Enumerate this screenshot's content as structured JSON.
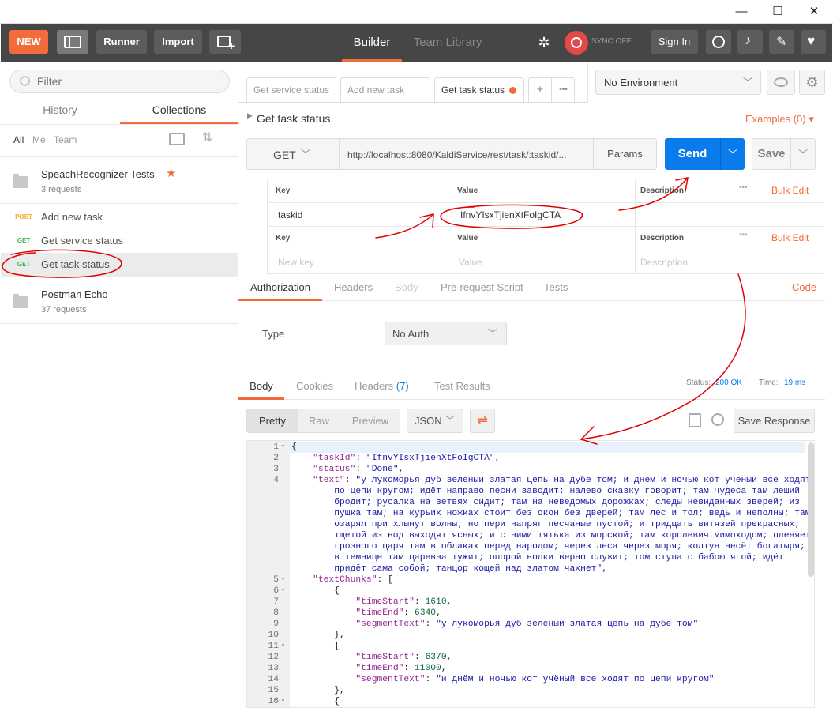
{
  "window": {
    "min": "—",
    "max": "☐",
    "close": "✕"
  },
  "topbar": {
    "new_label": "NEW",
    "runner_label": "Runner",
    "import_label": "Import",
    "builder_tab": "Builder",
    "team_library_tab": "Team Library",
    "sync_label": "SYNC OFF",
    "sign_in_label": "Sign In"
  },
  "sidebar": {
    "filter_placeholder": "Filter",
    "tabs": [
      "History",
      "Collections"
    ],
    "filters": [
      "All",
      "Me",
      "Team"
    ],
    "collections": [
      {
        "name": "SpeachRecognizer Tests",
        "count": "3 requests"
      },
      {
        "name": "Postman Echo",
        "count": "37 requests"
      }
    ],
    "requests": [
      {
        "method": "POST",
        "name": "Add new task"
      },
      {
        "method": "GET",
        "name": "Get service status"
      },
      {
        "method": "GET",
        "name": "Get task status"
      }
    ]
  },
  "tabs": [
    "Get service status",
    "Add new task",
    "Get task status"
  ],
  "tab_add": "+",
  "tab_more": "•••",
  "environment": "No Environment",
  "request": {
    "name": "Get task status",
    "examples": "Examples (0)",
    "method": "GET",
    "url": "http://localhost:8080/KaldiService/rest/task/:taskid/...",
    "params": "Params",
    "send": "Send",
    "save": "Save"
  },
  "path_vars": {
    "headers": [
      "Key",
      "Value",
      "Description"
    ],
    "bulk_edit": "Bulk Edit",
    "rows": [
      {
        "key": "taskid",
        "value": "IfnvYIsxTjienXtFoIgCTA",
        "description": ""
      }
    ]
  },
  "query_params": {
    "headers": [
      "Key",
      "Value",
      "Description"
    ],
    "bulk_edit": "Bulk Edit",
    "placeholders": {
      "key": "New key",
      "value": "Value",
      "description": "Description"
    }
  },
  "req_tabs": [
    "Authorization",
    "Headers",
    "Body",
    "Pre-request Script",
    "Tests"
  ],
  "code_link": "Code",
  "auth": {
    "type_label": "Type",
    "type_value": "No Auth"
  },
  "resp_tabs": {
    "body": "Body",
    "cookies": "Cookies",
    "headers": "Headers",
    "headers_count": "(7)",
    "tests": "Test Results"
  },
  "status": {
    "status_label": "Status:",
    "status_value": "200 OK",
    "time_label": "Time:",
    "time_value": "19 ms"
  },
  "view_modes": [
    "Pretty",
    "Raw",
    "Preview"
  ],
  "format": "JSON",
  "save_response": "Save Response",
  "json_lines": [
    {
      "n": "1",
      "fold": "▾",
      "code": "{"
    },
    {
      "n": "2",
      "fold": "",
      "code": "    \"taskId\": \"IfnvYIsxTjienXtFoIgCTA\","
    },
    {
      "n": "3",
      "fold": "",
      "code": "    \"status\": \"Done\","
    },
    {
      "n": "4",
      "fold": "",
      "code": "    \"text\": \"у лукоморья дуб зелёный златая цепь на дубе том; и днём и ночью кот учёный все ходят"
    },
    {
      "n": "",
      "fold": "",
      "code": "        по цепи кругом; идёт направо песни заводит; налево сказку говорит; там чудеса там леший"
    },
    {
      "n": "",
      "fold": "",
      "code": "        бродит; русалка на ветвях сидит; там на неведомых дорожках; следы невиданных зверей; из"
    },
    {
      "n": "",
      "fold": "",
      "code": "        пушка там; на курьих ножках стоит без окон без дверей; там лес и тол; ведь и неполны; там"
    },
    {
      "n": "",
      "fold": "",
      "code": "        озарял при хлынут волны; но пери напряг песчаные пустой; и тридцать витязей прекрасных;"
    },
    {
      "n": "",
      "fold": "",
      "code": "        тщетой из вод выходят ясных; и с ними тятька из морской; там королевич мимоходом; пленяет"
    },
    {
      "n": "",
      "fold": "",
      "code": "        грозного царя там в облаках перед народом; через леса через моря; колтун несёт богатыря;"
    },
    {
      "n": "",
      "fold": "",
      "code": "        в темнице там царевна тужит; опорой волки верно служит; том ступа с бабою ягой; идёт"
    },
    {
      "n": "",
      "fold": "",
      "code": "        придёт сама собой; танцор кощей над златом чахнет\","
    },
    {
      "n": "5",
      "fold": "▾",
      "code": "    \"textChunks\": ["
    },
    {
      "n": "6",
      "fold": "▾",
      "code": "        {"
    },
    {
      "n": "7",
      "fold": "",
      "code": "            \"timeStart\": 1610,"
    },
    {
      "n": "8",
      "fold": "",
      "code": "            \"timeEnd\": 6340,"
    },
    {
      "n": "9",
      "fold": "",
      "code": "            \"segmentText\": \"у лукоморья дуб зелёный златая цепь на дубе том\""
    },
    {
      "n": "10",
      "fold": "",
      "code": "        },"
    },
    {
      "n": "11",
      "fold": "▾",
      "code": "        {"
    },
    {
      "n": "12",
      "fold": "",
      "code": "            \"timeStart\": 6370,"
    },
    {
      "n": "13",
      "fold": "",
      "code": "            \"timeEnd\": 11000,"
    },
    {
      "n": "14",
      "fold": "",
      "code": "            \"segmentText\": \"и днём и ночью кот учёный все ходят по цепи кругом\""
    },
    {
      "n": "15",
      "fold": "",
      "code": "        },"
    },
    {
      "n": "16",
      "fold": "▾",
      "code": "        {"
    }
  ],
  "colors": {
    "accent": "#f26b3a",
    "send": "#097bed",
    "topbar": "#464646",
    "get": "#3bb34a",
    "post": "#f4a623",
    "annotation": "#e00000"
  }
}
